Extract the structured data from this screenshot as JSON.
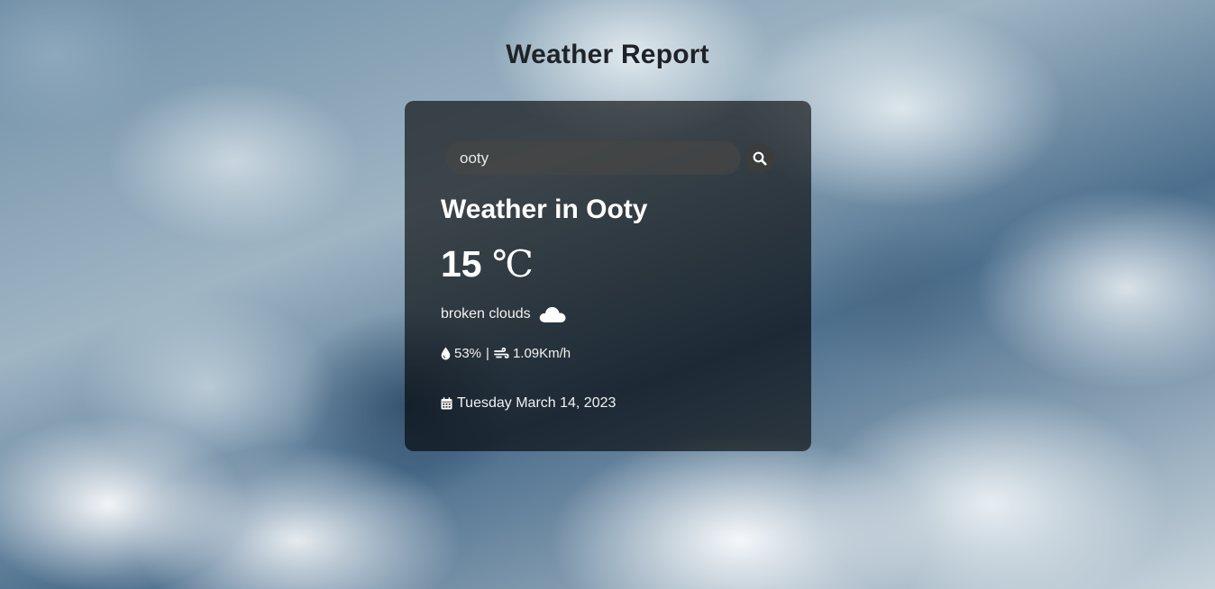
{
  "page": {
    "title": "Weather Report"
  },
  "search": {
    "value": "ooty",
    "button_icon": "search-icon"
  },
  "weather": {
    "heading": "Weather in Ooty",
    "temperature": "15",
    "unit": "℃",
    "description": "broken clouds",
    "condition_icon": "cloud-icon",
    "humidity": "53%",
    "humidity_icon": "droplet-icon",
    "separator": "|",
    "wind_speed": "1.09Km/h",
    "wind_icon": "wind-icon",
    "date": "Tuesday March 14, 2023",
    "date_icon": "calendar-icon"
  },
  "colors": {
    "card_background": "rgba(0,0,0,0.62)",
    "title_text": "#1f2326",
    "card_text": "#ffffff"
  }
}
